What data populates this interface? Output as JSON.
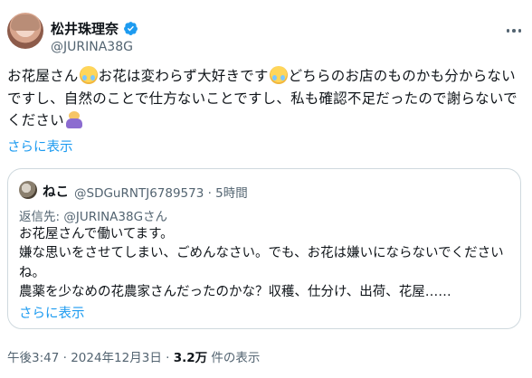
{
  "author": {
    "display_name": "松井珠理奈",
    "handle": "@JURINA38G"
  },
  "tweet": {
    "text_parts": [
      "お花屋さん",
      "お花は変わらず大好きです",
      "どちらのお店のものかも分からないですし、自然のことで仕方ないことですし、私も確認不足だったので謝らないでください"
    ],
    "show_more": "さらに表示"
  },
  "quote": {
    "name": "ねこ",
    "meta": "@SDGuRNTJ6789573 · 5時間",
    "reply_prefix": "返信先: ",
    "reply_mention": "@JURINA38Gさん",
    "text": "お花屋さんで働いてます。\n嫌な思いをさせてしまい、ごめんなさい。でも、お花は嫌いにならないでくださいね。\n農薬を少なめの花農家さんだったのかな？収穫、仕分け、出荷、花屋……",
    "show_more": "さらに表示"
  },
  "footer": {
    "timestamp": "午後3:47 · 2024年12月3日 · ",
    "views": "3.2万",
    "views_label": " 件の表示"
  },
  "icons": {
    "verified": "verified-badge-icon",
    "more": "more-options-icon",
    "emoji_pleading": "pleading-face-emoji",
    "emoji_bow": "person-bowing-emoji"
  },
  "colors": {
    "link": "#1d9bf0",
    "verified": "#1d9bf0",
    "secondary_text": "#536471",
    "border": "#cfd9de"
  }
}
